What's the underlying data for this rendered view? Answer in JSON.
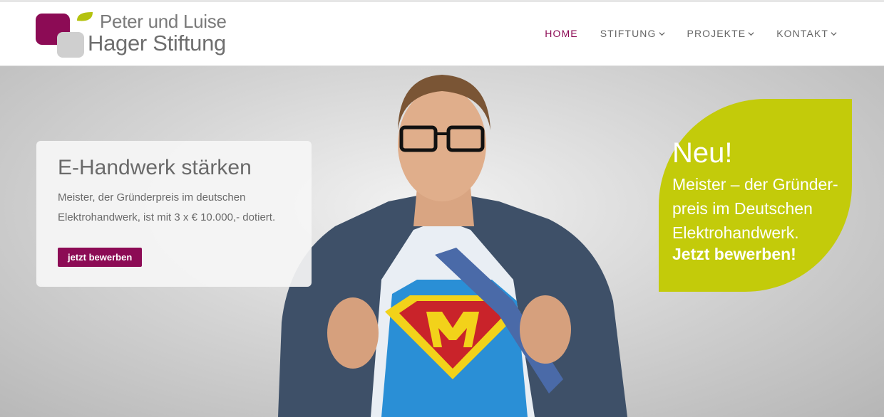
{
  "logo": {
    "line1": "Peter und Luise",
    "line2": "Hager Stiftung",
    "colors": {
      "magenta": "#8c0b55",
      "green": "#b4c20f",
      "gray": "#cfcfcf"
    }
  },
  "nav": {
    "items": [
      {
        "label": "HOME",
        "active": true,
        "dropdown": false
      },
      {
        "label": "STIFTUNG",
        "active": false,
        "dropdown": true
      },
      {
        "label": "PROJEKTE",
        "active": false,
        "dropdown": true
      },
      {
        "label": "KONTAKT",
        "active": false,
        "dropdown": true
      }
    ],
    "active_color": "#8c0b55"
  },
  "hero": {
    "card": {
      "title": "E-Handwerk stärken",
      "text": "Meister, der Gründerpreis im deutschen Elektrohandwerk, ist mit 3 x € 10.000,- dotiert.",
      "button_label": "jetzt bewerben"
    },
    "leaf": {
      "headline": "Neu!",
      "text": "Meister – der Gründer-preis im Deutschen Elektrohandwerk.",
      "cta": "Jetzt bewerben!",
      "color": "#c3cb0a"
    },
    "illustration": "superhero-businessman-image"
  }
}
